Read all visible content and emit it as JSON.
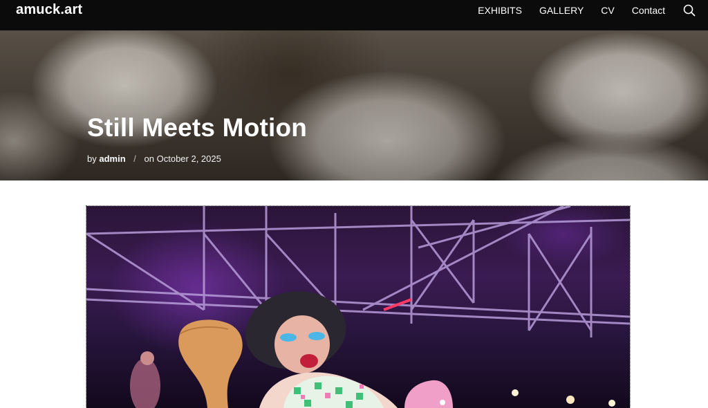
{
  "site": {
    "logo": "amuck.art"
  },
  "nav": {
    "items": [
      {
        "label": "EXHIBITS"
      },
      {
        "label": "GALLERY"
      },
      {
        "label": "CV"
      },
      {
        "label": "Contact"
      }
    ],
    "search_icon": "search-icon"
  },
  "post": {
    "title": "Still Meets Motion",
    "by_prefix": "by",
    "author": "admin",
    "date_prefix": "on",
    "date": "October 2, 2025"
  },
  "colors": {
    "header_bg": "#0b0b0c",
    "feature_tint": "#3b1b52"
  }
}
